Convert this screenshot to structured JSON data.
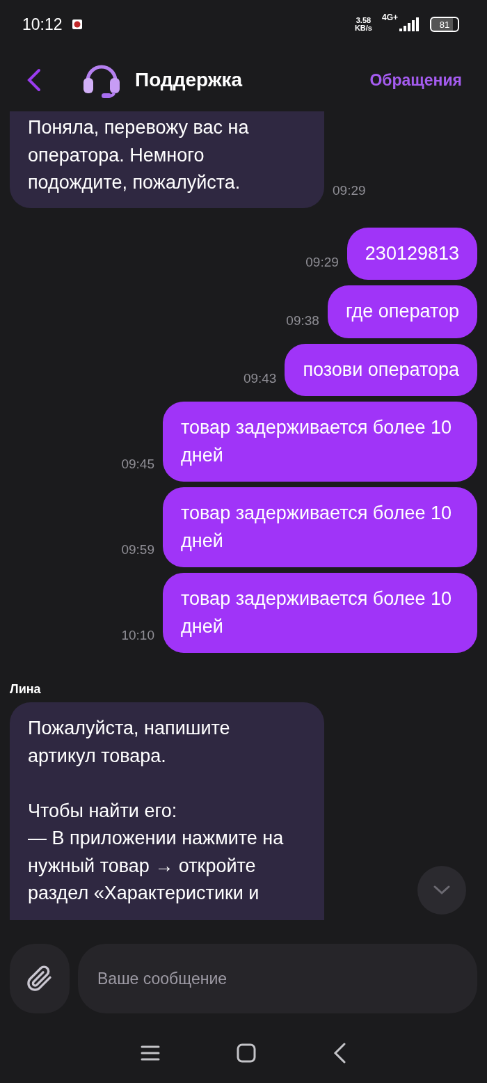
{
  "status_bar": {
    "time": "10:12",
    "speed_value": "3.58",
    "speed_unit": "KB/s",
    "network": "4G+",
    "battery": "81"
  },
  "header": {
    "title": "Поддержка",
    "action": "Обращения"
  },
  "messages": [
    {
      "kind": "incoming",
      "text": "Поняла, перевожу вас на оператора. Немного подождите, пожалуйста.",
      "time": "09:29"
    },
    {
      "kind": "outgoing",
      "text": "230129813",
      "time": "09:29"
    },
    {
      "kind": "outgoing",
      "text": "где оператор",
      "time": "09:38"
    },
    {
      "kind": "outgoing",
      "text": "позови оператора",
      "time": "09:43"
    },
    {
      "kind": "outgoing",
      "text": "товар задерживается более 10 дней",
      "time": "09:45"
    },
    {
      "kind": "outgoing",
      "text": "товар задерживается более 10 дней",
      "time": "09:59"
    },
    {
      "kind": "outgoing",
      "text": "товар задерживается более 10 дней",
      "time": "10:10"
    },
    {
      "kind": "incoming",
      "sender": "Лина",
      "text": "Пожалуйста, напишите артикул товара.\n\nЧтобы найти его:\n— В приложении нажмите на нужный товар → откройте раздел «Характеристики и"
    }
  ],
  "composer": {
    "placeholder": "Ваше сообщение"
  }
}
